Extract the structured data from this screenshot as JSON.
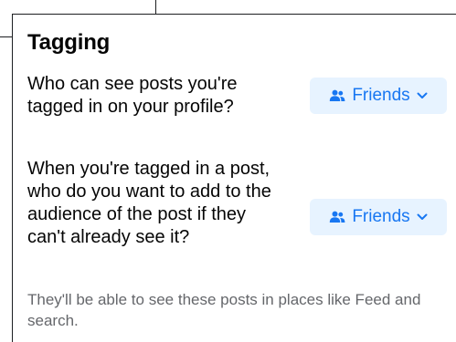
{
  "section": {
    "title": "Tagging"
  },
  "settings": [
    {
      "label": "Who can see posts you're tagged in on your profile?",
      "value": "Friends",
      "icon": "friends-icon"
    },
    {
      "label": "When you're tagged in a post, who do you want to add to the audience of the post if they can't already see it?",
      "value": "Friends",
      "icon": "friends-icon"
    }
  ],
  "note": "They'll be able to see these posts in places like Feed and search.",
  "colors": {
    "accent": "#1877f2",
    "button_bg": "#e7f3ff",
    "text": "#050505",
    "secondary_text": "#65676b"
  }
}
